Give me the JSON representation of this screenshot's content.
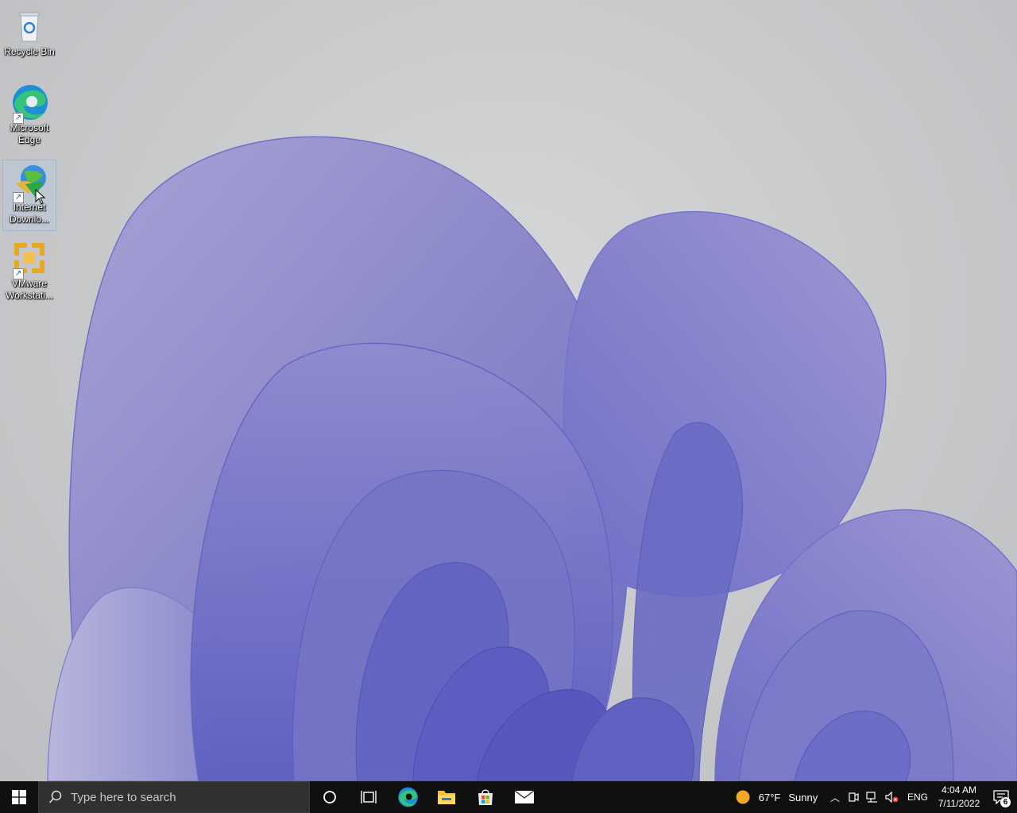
{
  "desktop": {
    "icons": [
      {
        "label": "Recycle Bin",
        "icon": "recycle-bin-icon"
      },
      {
        "label": "Microsoft Edge",
        "icon": "edge-icon"
      },
      {
        "label": "Internet Downlo...",
        "icon": "internet-download-manager-icon"
      },
      {
        "label": "VMware Workstati...",
        "icon": "vmware-workstation-icon"
      }
    ]
  },
  "taskbar": {
    "search_placeholder": "Type here to search",
    "apps": [
      "cortana-icon",
      "task-view-icon",
      "edge-icon",
      "file-explorer-icon",
      "microsoft-store-icon",
      "mail-icon"
    ],
    "weather": {
      "temp": "67°F",
      "condition": "Sunny"
    },
    "language": "ENG",
    "time": "4:04 AM",
    "date": "7/11/2022",
    "notification_count": "6"
  },
  "colors": {
    "taskbar": "#101010",
    "search_box": "#303030",
    "wallpaper_petal": "#8c8ccf"
  }
}
